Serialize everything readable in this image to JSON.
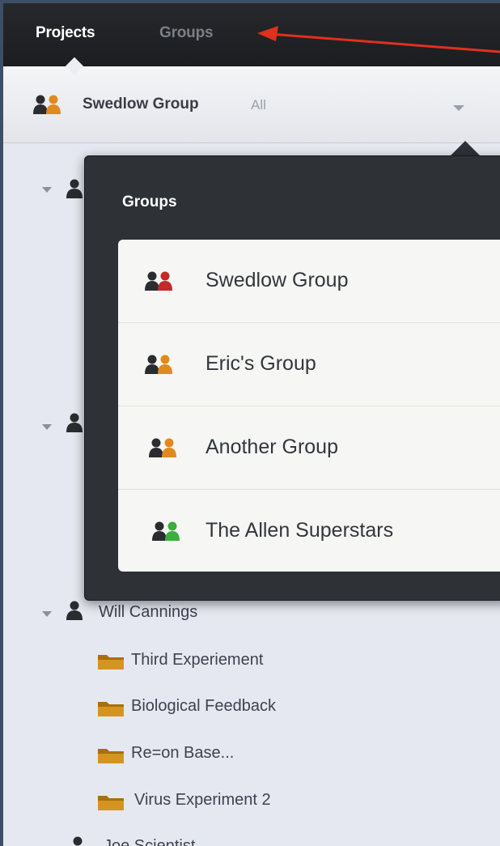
{
  "topbar": {
    "tabs": [
      {
        "label": "Projects",
        "active": true
      },
      {
        "label": "Groups",
        "active": false
      }
    ]
  },
  "selector": {
    "group_name": "Swedlow Group",
    "filter": "All"
  },
  "popover": {
    "title": "Groups",
    "items": [
      {
        "label": "Swedlow Group",
        "color": "#c62828"
      },
      {
        "label": "Eric's Group",
        "color": "#e08a1e"
      },
      {
        "label": "Another Group",
        "color": "#e08a1e"
      },
      {
        "label": "The Allen Superstars",
        "color": "#3cae3c"
      }
    ]
  },
  "tree": {
    "users": [
      {
        "name": "Will Cannings"
      },
      {
        "name": "Joe Scientist"
      }
    ],
    "folders": [
      {
        "label": "Third Experiement"
      },
      {
        "label": "Biological Feedback"
      },
      {
        "label": "Re=on Base..."
      },
      {
        "label": "Virus Experiment 2"
      }
    ]
  },
  "colors": {
    "annotation_arrow": "#e0301e",
    "folder": "#c88a12",
    "accent_dark": "#2e3136"
  }
}
